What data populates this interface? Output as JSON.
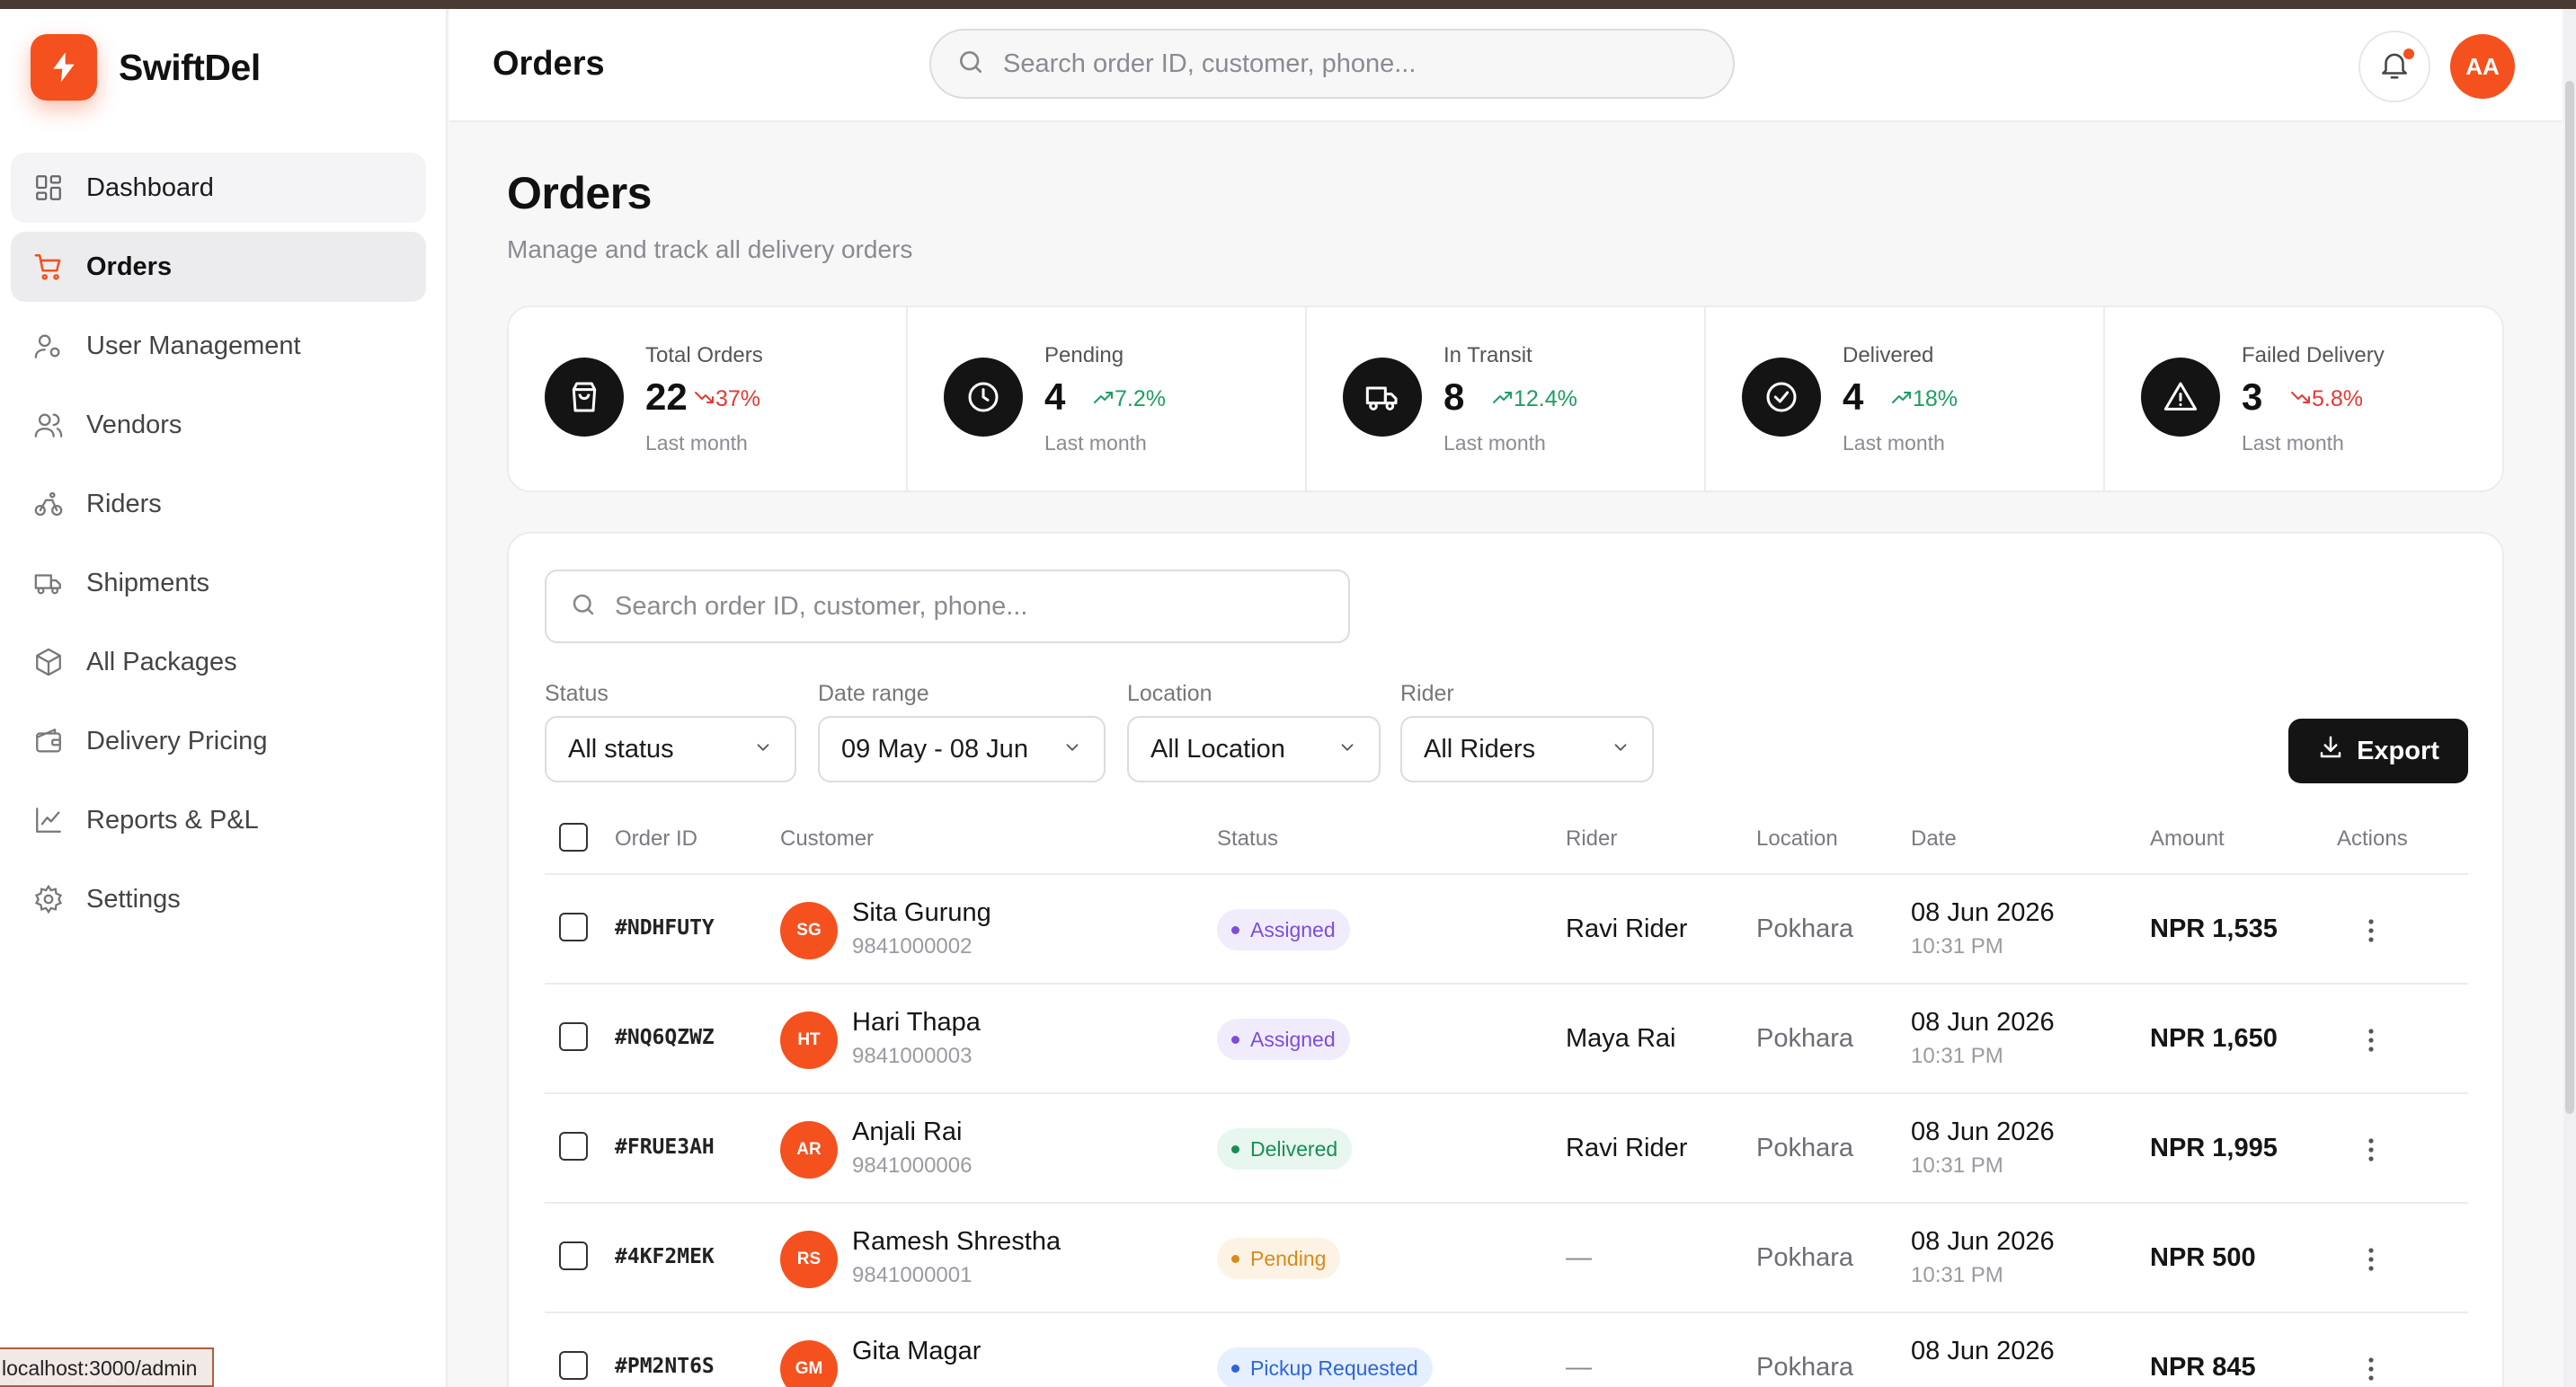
{
  "brand": {
    "name": "SwiftDel",
    "accent": "#f4511e"
  },
  "nav": [
    {
      "label": "Dashboard",
      "icon": "dashboard-grid-icon"
    },
    {
      "label": "Orders",
      "icon": "cart-icon"
    },
    {
      "label": "User Management",
      "icon": "user-cog-icon"
    },
    {
      "label": "Vendors",
      "icon": "users-icon"
    },
    {
      "label": "Riders",
      "icon": "bike-icon"
    },
    {
      "label": "Shipments",
      "icon": "truck-icon"
    },
    {
      "label": "All Packages",
      "icon": "package-icon"
    },
    {
      "label": "Delivery Pricing",
      "icon": "wallet-icon"
    },
    {
      "label": "Reports & P&L",
      "icon": "line-chart-icon"
    },
    {
      "label": "Settings",
      "icon": "gear-icon"
    }
  ],
  "status_url": "localhost:3000/admin",
  "header": {
    "title": "Orders",
    "search_placeholder": "Search order ID, customer, phone...",
    "user_initials": "AA"
  },
  "page": {
    "title": "Orders",
    "subtitle": "Manage and track all delivery orders"
  },
  "stats": [
    {
      "label": "Total Orders",
      "value": "22",
      "change": "37%",
      "trend": "down",
      "period": "Last month",
      "icon": "shopping-bag-icon"
    },
    {
      "label": "Pending",
      "value": "4",
      "change": "7.2%",
      "trend": "up",
      "period": "Last month",
      "icon": "clock-icon"
    },
    {
      "label": "In Transit",
      "value": "8",
      "change": "12.4%",
      "trend": "up",
      "period": "Last month",
      "icon": "truck-icon"
    },
    {
      "label": "Delivered",
      "value": "4",
      "change": "18%",
      "trend": "up",
      "period": "Last month",
      "icon": "check-circle-icon"
    },
    {
      "label": "Failed Delivery",
      "value": "3",
      "change": "5.8%",
      "trend": "down",
      "period": "Last month",
      "icon": "warning-triangle-icon"
    }
  ],
  "filters": {
    "search_placeholder": "Search order ID, customer, phone...",
    "status": {
      "label": "Status",
      "value": "All status"
    },
    "date_range": {
      "label": "Date range",
      "value": "09 May - 08 Jun"
    },
    "location": {
      "label": "Location",
      "value": "All Location"
    },
    "rider": {
      "label": "Rider",
      "value": "All Riders"
    },
    "export_label": "Export"
  },
  "table": {
    "columns": [
      "Order ID",
      "Customer",
      "Status",
      "Rider",
      "Location",
      "Date",
      "Amount",
      "Actions"
    ],
    "rows": [
      {
        "id": "#NDHFUTY",
        "initials": "SG",
        "name": "Sita Gurung",
        "phone": "9841000002",
        "status": "Assigned",
        "status_kind": "assigned",
        "rider": "Ravi Rider",
        "location": "Pokhara",
        "date": "08 Jun 2026",
        "time": "10:31 PM",
        "amount": "NPR 1,535"
      },
      {
        "id": "#NQ6QZWZ",
        "initials": "HT",
        "name": "Hari Thapa",
        "phone": "9841000003",
        "status": "Assigned",
        "status_kind": "assigned",
        "rider": "Maya Rai",
        "location": "Pokhara",
        "date": "08 Jun 2026",
        "time": "10:31 PM",
        "amount": "NPR 1,650"
      },
      {
        "id": "#FRUE3AH",
        "initials": "AR",
        "name": "Anjali Rai",
        "phone": "9841000006",
        "status": "Delivered",
        "status_kind": "delivered",
        "rider": "Ravi Rider",
        "location": "Pokhara",
        "date": "08 Jun 2026",
        "time": "10:31 PM",
        "amount": "NPR 1,995"
      },
      {
        "id": "#4KF2MEK",
        "initials": "RS",
        "name": "Ramesh Shrestha",
        "phone": "9841000001",
        "status": "Pending",
        "status_kind": "pending",
        "rider": "—",
        "location": "Pokhara",
        "date": "08 Jun 2026",
        "time": "10:31 PM",
        "amount": "NPR 500"
      },
      {
        "id": "#PM2NT6S",
        "initials": "GM",
        "name": "Gita Magar",
        "phone": "",
        "status": "Pickup Requested",
        "status_kind": "pickup",
        "rider": "—",
        "location": "Pokhara",
        "date": "08 Jun 2026",
        "time": "",
        "amount": "NPR 845"
      }
    ]
  }
}
